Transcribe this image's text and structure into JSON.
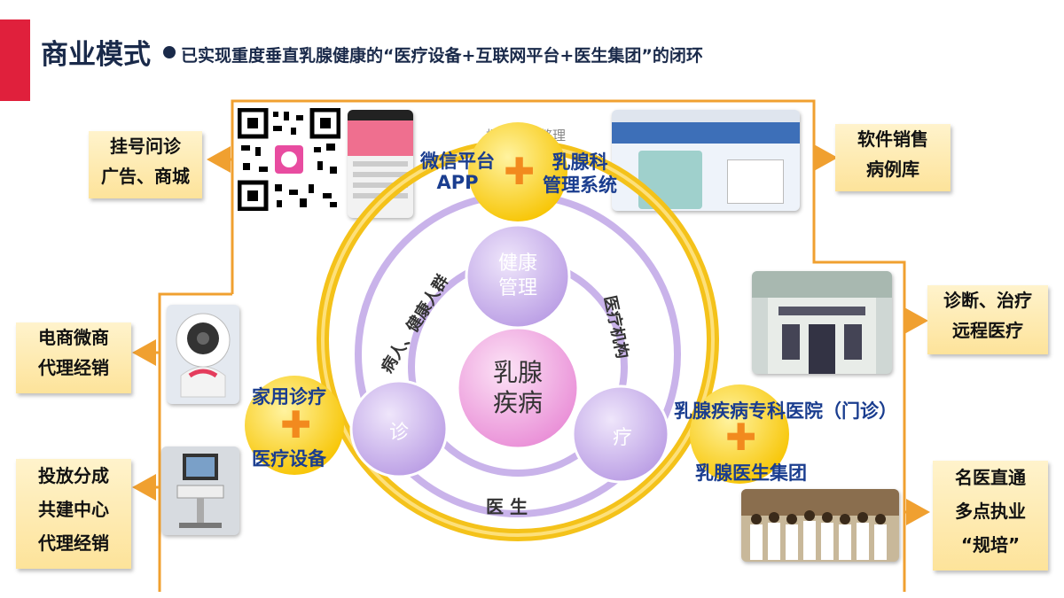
{
  "header": {
    "title": "商业模式",
    "subtitle": "已实现重度垂直乳腺健康的“医疗设备+互联网平台+医生集团”的闭环"
  },
  "left_boxes": {
    "box1": [
      "挂号问诊",
      "广告、商城"
    ],
    "box2": [
      "电商微商",
      "代理经销"
    ],
    "box3": [
      "投放分成",
      "共建中心",
      "代理经销"
    ]
  },
  "right_boxes": {
    "box1": [
      "软件销售",
      "病例库"
    ],
    "box2": [
      "诊断、治疗",
      "远程医疗"
    ],
    "box3": [
      "名医直通",
      "多点执业",
      "“规培”"
    ]
  },
  "nodes": {
    "top": {
      "left": [
        "微信平台",
        "APP"
      ],
      "right": [
        "乳腺科",
        "管理系统"
      ]
    },
    "left": {
      "top": "家用诊疗",
      "bottom": "医疗设备"
    },
    "right": {
      "top": "乳腺疾病专科医院（门诊）",
      "bottom": "乳腺医生集团"
    }
  },
  "watermark": "梧桐树下整理",
  "center": {
    "core": [
      "乳腺",
      "疾病"
    ],
    "health": [
      "健康",
      "管理"
    ],
    "diagnose": "诊",
    "treat": "疗",
    "rim_left": "病人、健康人群",
    "rim_right": "医疗机构",
    "rim_bottom": "医 生"
  },
  "colors": {
    "accent_red": "#e0203c",
    "orange_line": "#f0a030",
    "title_navy": "#1a2a4a",
    "text_blue": "#1a3d8f",
    "gold": "#f7c400",
    "lavender": "#c9b3ea",
    "pink_core": "#f4b2e6"
  },
  "icons": [
    "qr-code-icon",
    "plus-icon",
    "robot-device-icon",
    "ultrasound-cart-icon",
    "hospital-building-icon",
    "doctor-group-icon"
  ]
}
